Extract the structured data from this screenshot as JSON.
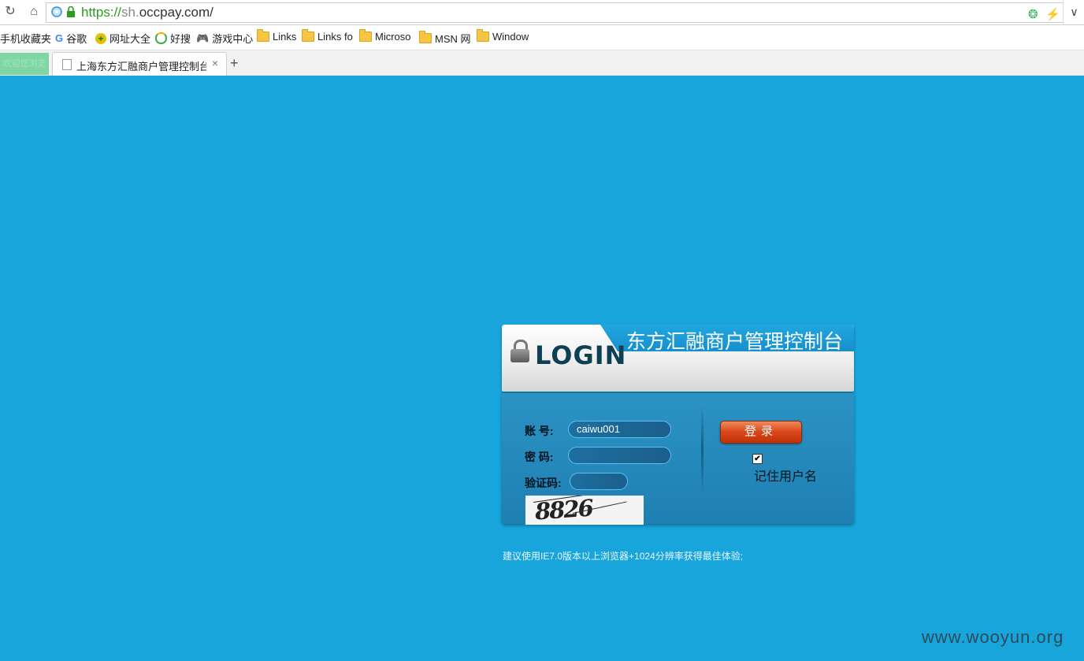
{
  "browser": {
    "url_scheme": "https://",
    "url_subdomain": "sh.",
    "url_host": "occpay.com/",
    "bookmarks": [
      {
        "label": "手机收藏夹",
        "icon": "none"
      },
      {
        "label": "谷歌",
        "icon": "google-icon"
      },
      {
        "label": "网址大全",
        "icon": "plus-icon"
      },
      {
        "label": "好搜",
        "icon": "search-icon"
      },
      {
        "label": "游戏中心",
        "icon": "gamepad-icon"
      },
      {
        "label": "Links",
        "icon": "folder-icon"
      },
      {
        "label": "Links fo",
        "icon": "folder-icon"
      },
      {
        "label": "Microso",
        "icon": "folder-icon"
      },
      {
        "label": "MSN 网",
        "icon": "folder-icon"
      },
      {
        "label": "Window",
        "icon": "folder-icon"
      }
    ],
    "tab_green_label": "欢迎您浏览",
    "tab_active_title": "上海东方汇融商户管理控制台 §",
    "new_tab_glyph": "+",
    "close_glyph": "×"
  },
  "login": {
    "heading_logo": "LOGIN",
    "title": "东方汇融商户管理控制台",
    "account_label": "账 号:",
    "account_value": "caiwu001",
    "password_label": "密 码:",
    "password_value": "",
    "captcha_label": "验证码:",
    "captcha_value": "",
    "captcha_image_text": "8826",
    "submit_label": "登录",
    "remember_checked": true,
    "remember_label": "记住用户名"
  },
  "footer": {
    "hint": "建议使用IE7.0版本以上浏览器+1024分辨率获得最佳体验;",
    "watermark": "www.wooyun.org"
  },
  "colors": {
    "page_background": "#18a5dc",
    "title_band": "#168fcd",
    "login_button": "#d9461a"
  }
}
